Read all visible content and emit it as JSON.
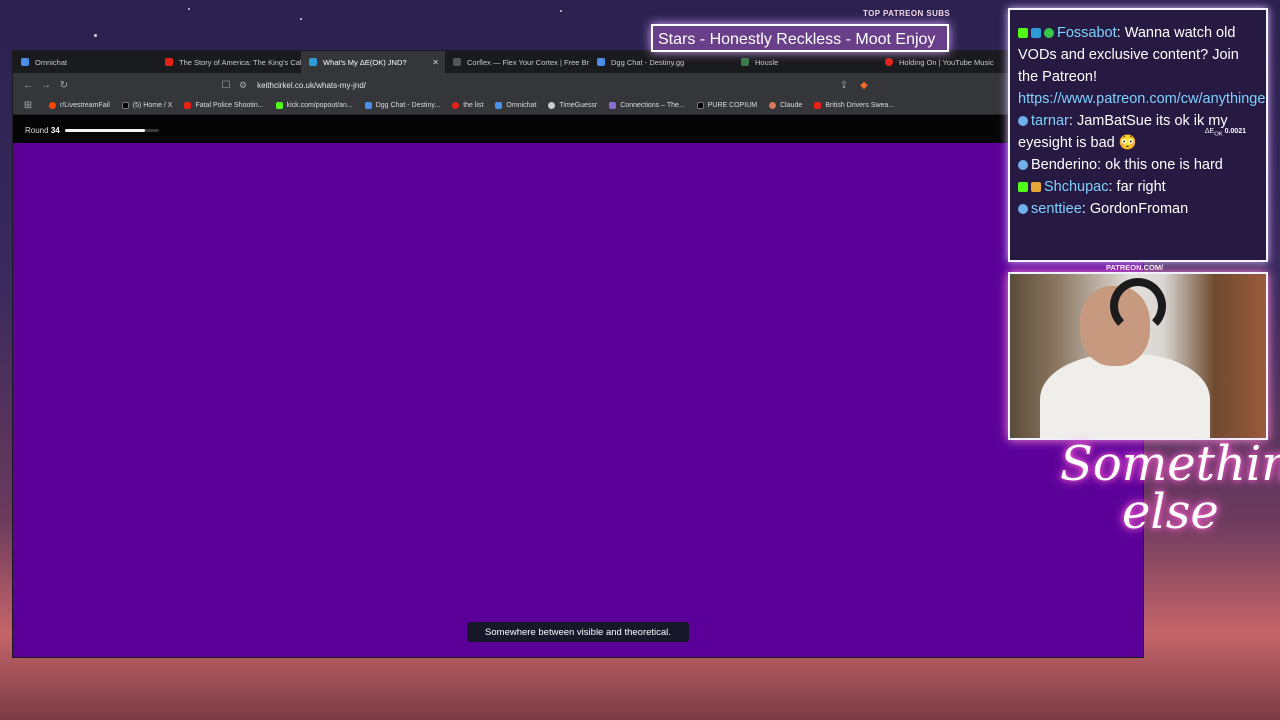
{
  "stream_overlay": {
    "top_patreon_subs_label": "TOP PATREON SUBS",
    "now_playing": "Stars - Honestly Reckless - Moot Enjoy",
    "patreon_label": "PATREON.COM/",
    "logo_line1": "Something",
    "logo_line2": "else"
  },
  "browser": {
    "tabs": [
      {
        "label": "Omnichat",
        "active": false
      },
      {
        "label": "The Story of America: The King's Call",
        "active": false
      },
      {
        "label": "What's My ΔE(OK) JND?",
        "active": true
      },
      {
        "label": "Corflex — Flex Your Cortex | Free Brain",
        "active": false
      },
      {
        "label": "Dgg Chat - Destiny.gg",
        "active": false
      },
      {
        "label": "Housle",
        "active": false
      },
      {
        "label": "Holding On | YouTube Music",
        "active": false
      }
    ],
    "url": "keithcirkel.co.uk/whats-my-jnd/",
    "bookmarks": [
      "r/LivestreamFail",
      "(5) Home / X",
      "Fatal Police Shootin...",
      "kick.com/popout/an...",
      "Dgg Chat - Destiny...",
      "the list",
      "Omnichat",
      "TimeGuessr",
      "Connections – The...",
      "PURE COPIUM",
      "Claude",
      "British Drivers Swea..."
    ]
  },
  "page": {
    "round_label": "Round",
    "round_number": "34",
    "progress": 0.85,
    "background_color": "#5a0099",
    "toast": "Somewhere between visible and theoretical."
  },
  "delta_e": {
    "label": "ΔE",
    "sub": "OK",
    "value": "0.0021"
  },
  "chat": {
    "messages": [
      {
        "user": "Fossabot",
        "color": "#7fd1ff",
        "text": ": Wanna watch old VODs and exclusive content? Join the Patreon! ",
        "link": "https://www.patreon.com/cw/anythingelse"
      },
      {
        "user": "tarnar",
        "color": "#7fd1ff",
        "text": ": JamBatSue its ok ik my eyesight is bad 😳",
        "link": ""
      },
      {
        "user": "Benderino",
        "color": "#ffffff",
        "text": ": ok this one is hard",
        "link": ""
      },
      {
        "user": "Shchupac",
        "color": "#7fd1ff",
        "text": ": far right",
        "link": ""
      },
      {
        "user": "senttiee",
        "color": "#7fd1ff",
        "text": ": GordonFroman",
        "link": ""
      }
    ]
  }
}
